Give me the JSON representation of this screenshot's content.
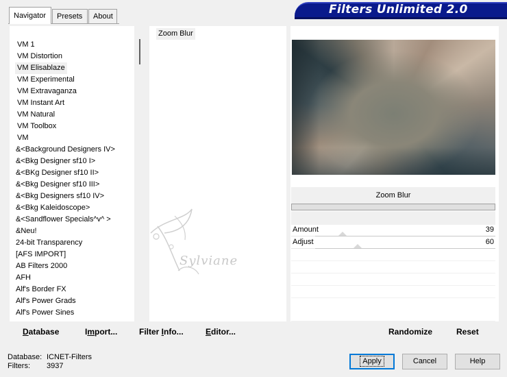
{
  "tabs": [
    "Navigator",
    "Presets",
    "About"
  ],
  "app_title": "Filters Unlimited 2.0",
  "categories": [
    "VM 1",
    "VM Distortion",
    "VM Elisablaze",
    "VM Experimental",
    "VM Extravaganza",
    "VM Instant Art",
    "VM Natural",
    "VM Toolbox",
    "VM",
    "&<Background Designers IV>",
    "&<Bkg Designer sf10 I>",
    "&<BKg Designer sf10 II>",
    "&<Bkg Designer sf10 III>",
    "&<Bkg Designers sf10 IV>",
    "&<Bkg Kaleidoscope>",
    "&<Sandflower Specials^v^ >",
    "&Neu!",
    "24-bit Transparency",
    "[AFS IMPORT]",
    "AB Filters 2000",
    "AFH",
    "Alf's Border FX",
    "Alf's Power Grads",
    "Alf's Power Sines"
  ],
  "selected_category": "VM Elisablaze",
  "filters": [
    "Zoom Blur"
  ],
  "filter_title": "Zoom Blur",
  "params": [
    {
      "label": "Amount",
      "value": "39",
      "fraction": 0.153
    },
    {
      "label": "Adjust",
      "value": "60",
      "fraction": 0.235
    }
  ],
  "toolbar": {
    "database_u": "D",
    "database_rest": "atabase",
    "import_pre": "I",
    "import_u": "m",
    "import_rest": "port...",
    "info_pre": "Filter ",
    "info_u": "I",
    "info_rest": "nfo...",
    "editor_u": "E",
    "editor_rest": "ditor...",
    "randomize": "Randomize",
    "reset": "Reset"
  },
  "info": {
    "database_label": "Database:",
    "database_value": "ICNET-Filters",
    "filters_label": "Filters:",
    "filters_value": "3937"
  },
  "buttons": {
    "apply": "Apply",
    "cancel": "Cancel",
    "help": "Help"
  },
  "watermark_text": "Sylviane",
  "colors": {
    "banner": "#0a1a8c",
    "panel_bg": "#f0f0f0",
    "default_button_border": "#0078d7"
  }
}
